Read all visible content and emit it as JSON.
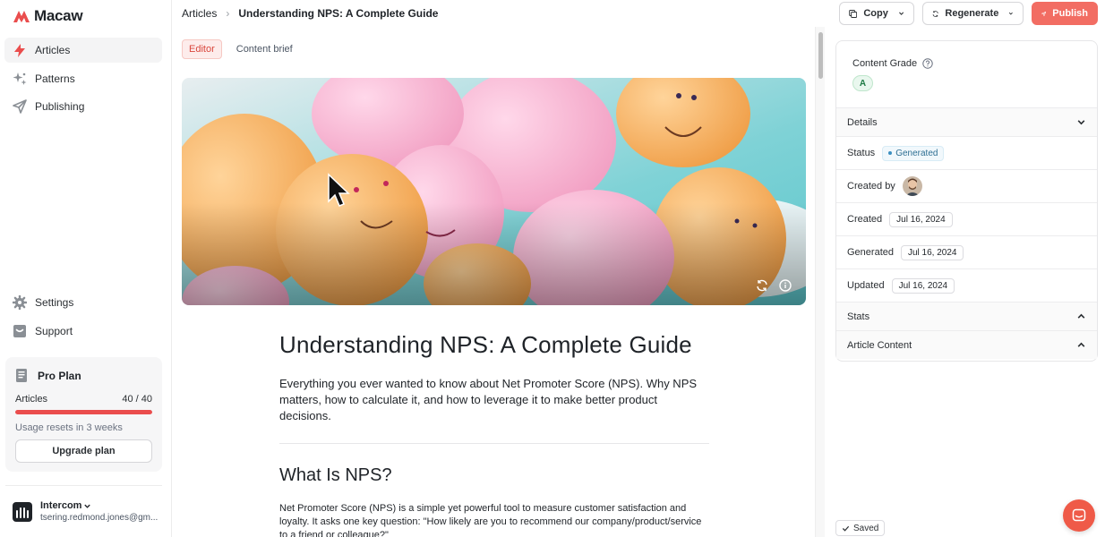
{
  "app": {
    "name": "Macaw"
  },
  "sidebar": {
    "nav": [
      {
        "label": "Articles",
        "icon": "bolt-icon",
        "active": true
      },
      {
        "label": "Patterns",
        "icon": "sparkle-icon",
        "active": false
      },
      {
        "label": "Publishing",
        "icon": "send-icon",
        "active": false
      }
    ],
    "bottom_nav": [
      {
        "label": "Settings",
        "icon": "gear-icon"
      },
      {
        "label": "Support",
        "icon": "support-icon"
      }
    ],
    "plan": {
      "title": "Pro Plan",
      "articles_label": "Articles",
      "articles_count": "40 / 40",
      "usage_fraction": 1.0,
      "reset_note": "Usage resets in 3 weeks",
      "upgrade_label": "Upgrade plan"
    },
    "account": {
      "org": "Intercom",
      "email": "tsering.redmond.jones@gm..."
    }
  },
  "header": {
    "breadcrumb_root": "Articles",
    "breadcrumb_current": "Understanding NPS: A Complete Guide",
    "copy_label": "Copy",
    "regenerate_label": "Regenerate",
    "publish_label": "Publish"
  },
  "editor": {
    "tabs": [
      {
        "label": "Editor",
        "active": true
      },
      {
        "label": "Content brief",
        "active": false
      }
    ],
    "title": "Understanding NPS: A Complete Guide",
    "lede": "Everything you ever wanted to know about Net Promoter Score (NPS). Why NPS matters, how to calculate it, and how to leverage it to make better product decisions.",
    "h2": "What Is NPS?",
    "body": "Net Promoter Score (NPS) is a simple yet powerful tool to measure customer satisfaction and loyalty. It asks one key question: \"How likely are you to recommend our company/product/service to a friend or colleague?\""
  },
  "panel": {
    "grade_label": "Content Grade",
    "grade_value": "A",
    "details_label": "Details",
    "status_label": "Status",
    "status_value": "Generated",
    "created_by_label": "Created by",
    "created_label": "Created",
    "created_value": "Jul 16, 2024",
    "generated_label": "Generated",
    "generated_value": "Jul 16, 2024",
    "updated_label": "Updated",
    "updated_value": "Jul 16, 2024",
    "stats_label": "Stats",
    "article_content_label": "Article Content"
  },
  "footer": {
    "saved_label": "Saved"
  },
  "colors": {
    "accent": "#f26d63",
    "brand_red": "#ea4d4d",
    "grade_green": "#1f7a45"
  }
}
